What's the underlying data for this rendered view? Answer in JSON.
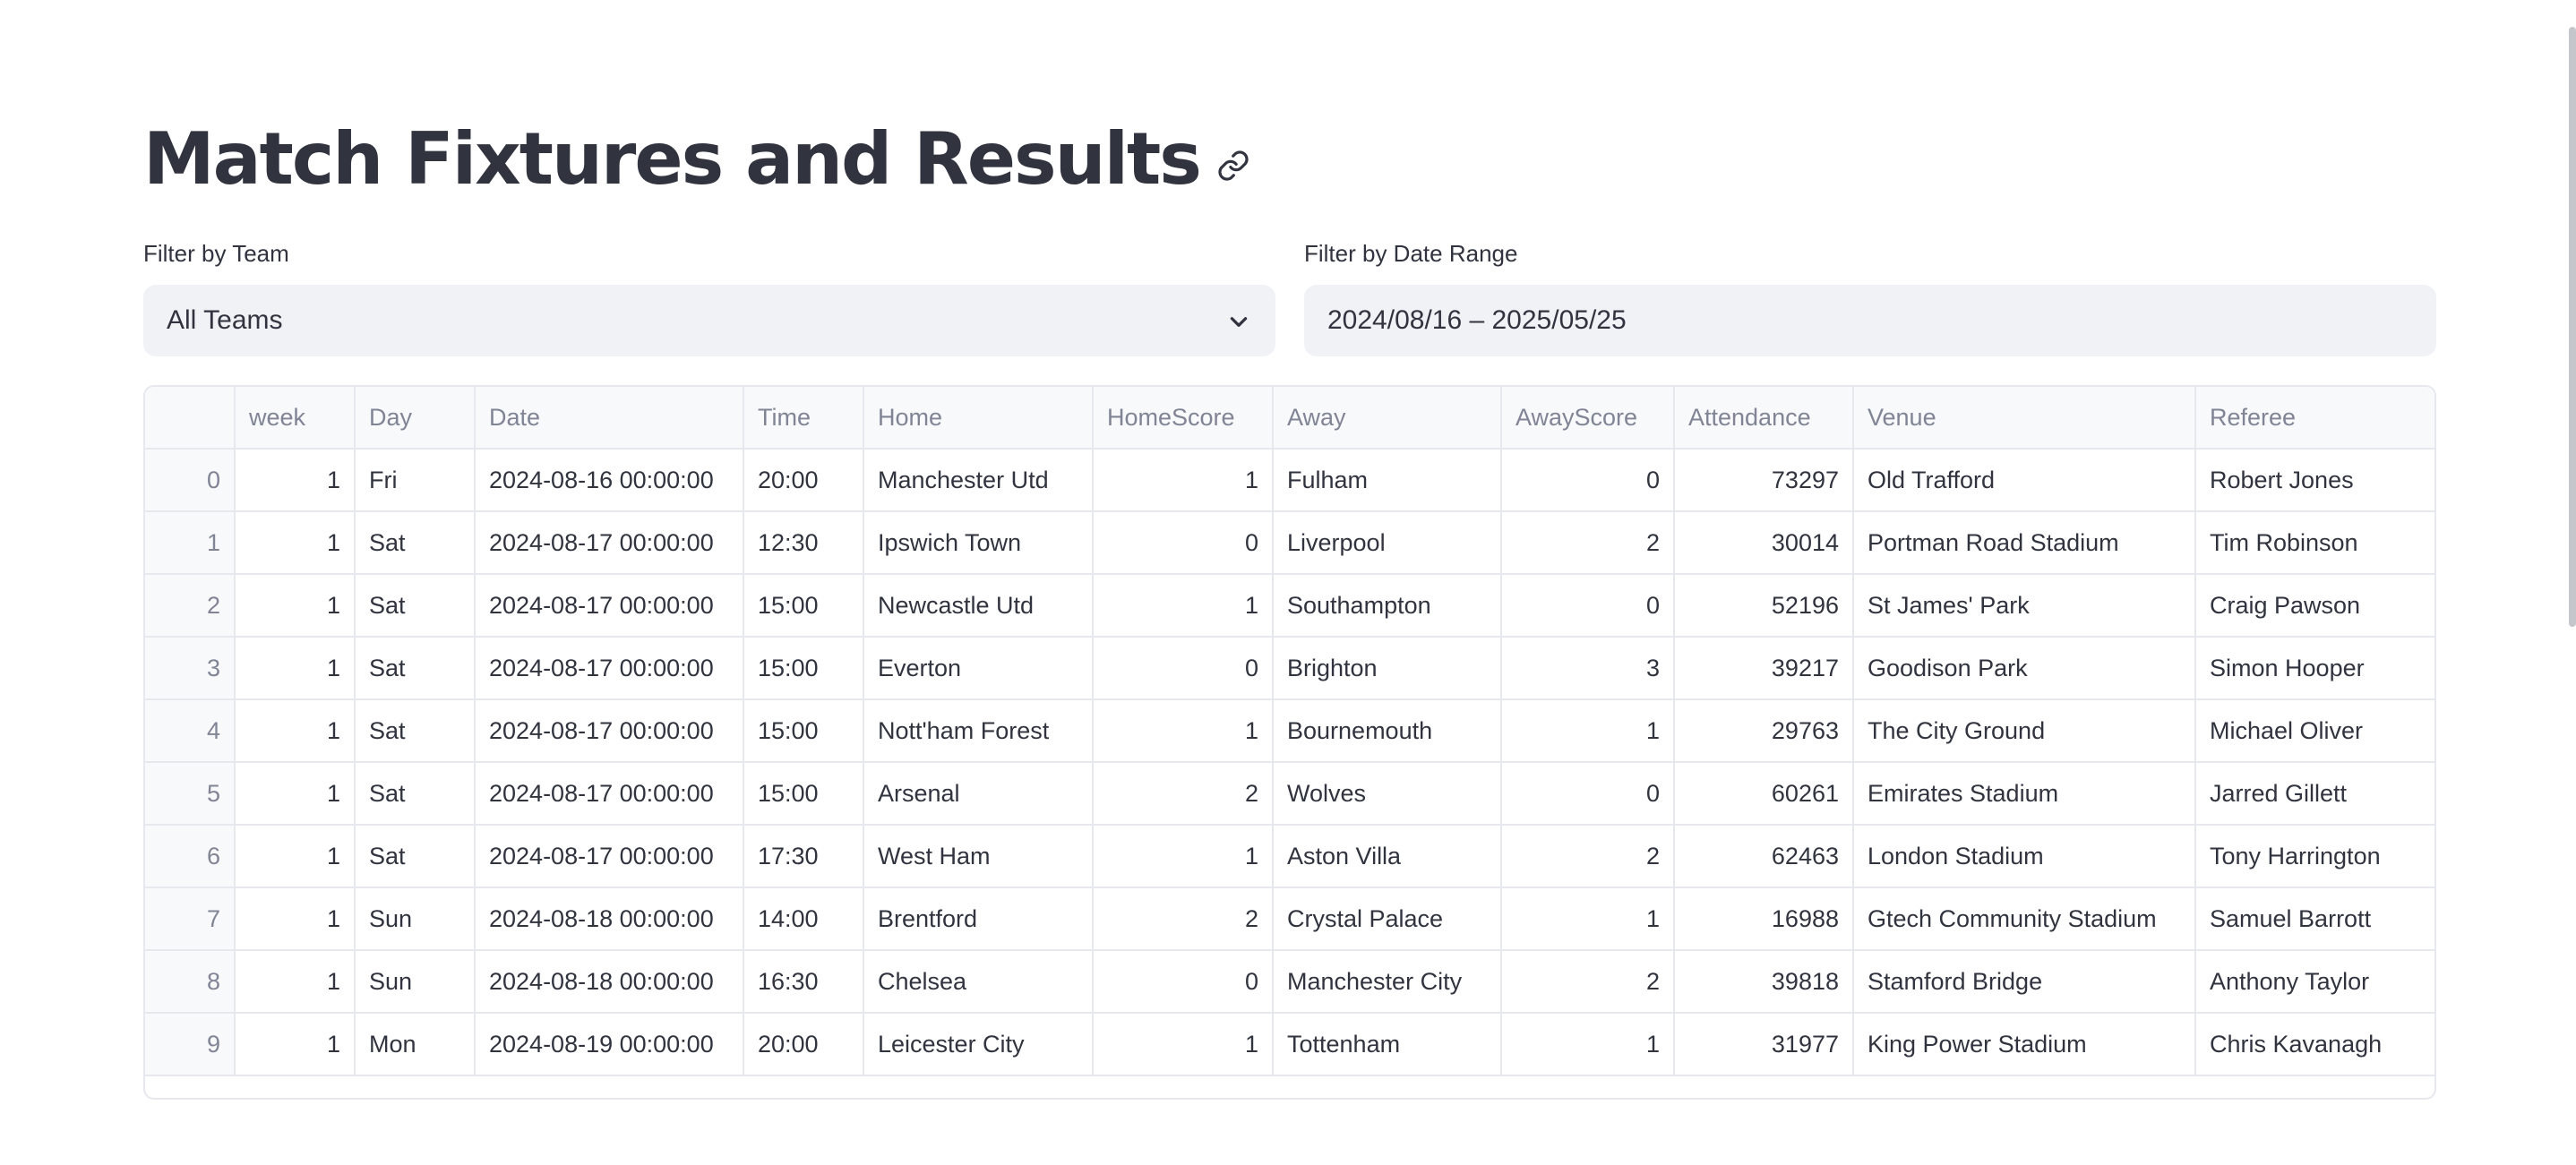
{
  "page": {
    "title": "Match Fixtures and Results"
  },
  "filters": {
    "team_label": "Filter by Team",
    "team_value": "All Teams",
    "date_label": "Filter by Date Range",
    "date_value": "2024/08/16 – 2025/05/25"
  },
  "table": {
    "columns": [
      "",
      "week",
      "Day",
      "Date",
      "Time",
      "Home",
      "HomeScore",
      "Away",
      "AwayScore",
      "Attendance",
      "Venue",
      "Referee"
    ],
    "rows": [
      [
        "0",
        "1",
        "Fri",
        "2024-08-16 00:00:00",
        "20:00",
        "Manchester Utd",
        "1",
        "Fulham",
        "0",
        "73297",
        "Old Trafford",
        "Robert Jones"
      ],
      [
        "1",
        "1",
        "Sat",
        "2024-08-17 00:00:00",
        "12:30",
        "Ipswich Town",
        "0",
        "Liverpool",
        "2",
        "30014",
        "Portman Road Stadium",
        "Tim Robinson"
      ],
      [
        "2",
        "1",
        "Sat",
        "2024-08-17 00:00:00",
        "15:00",
        "Newcastle Utd",
        "1",
        "Southampton",
        "0",
        "52196",
        "St James' Park",
        "Craig Pawson"
      ],
      [
        "3",
        "1",
        "Sat",
        "2024-08-17 00:00:00",
        "15:00",
        "Everton",
        "0",
        "Brighton",
        "3",
        "39217",
        "Goodison Park",
        "Simon Hooper"
      ],
      [
        "4",
        "1",
        "Sat",
        "2024-08-17 00:00:00",
        "15:00",
        "Nott'ham Forest",
        "1",
        "Bournemouth",
        "1",
        "29763",
        "The City Ground",
        "Michael Oliver"
      ],
      [
        "5",
        "1",
        "Sat",
        "2024-08-17 00:00:00",
        "15:00",
        "Arsenal",
        "2",
        "Wolves",
        "0",
        "60261",
        "Emirates Stadium",
        "Jarred Gillett"
      ],
      [
        "6",
        "1",
        "Sat",
        "2024-08-17 00:00:00",
        "17:30",
        "West Ham",
        "1",
        "Aston Villa",
        "2",
        "62463",
        "London Stadium",
        "Tony Harrington"
      ],
      [
        "7",
        "1",
        "Sun",
        "2024-08-18 00:00:00",
        "14:00",
        "Brentford",
        "2",
        "Crystal Palace",
        "1",
        "16988",
        "Gtech Community Stadium",
        "Samuel Barrott"
      ],
      [
        "8",
        "1",
        "Sun",
        "2024-08-18 00:00:00",
        "16:30",
        "Chelsea",
        "0",
        "Manchester City",
        "2",
        "39818",
        "Stamford Bridge",
        "Anthony Taylor"
      ],
      [
        "9",
        "1",
        "Mon",
        "2024-08-19 00:00:00",
        "20:00",
        "Leicester City",
        "1",
        "Tottenham",
        "1",
        "31977",
        "King Power Stadium",
        "Chris Kavanagh"
      ]
    ]
  },
  "icons": {
    "anchor": "link-icon",
    "dropdown": "chevron-down-icon"
  }
}
